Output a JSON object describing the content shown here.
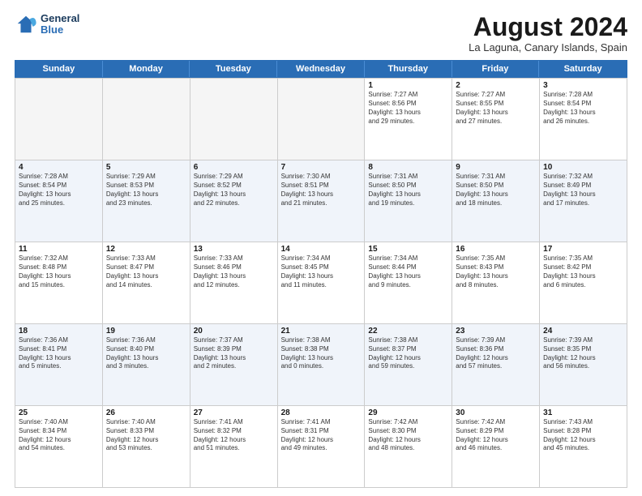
{
  "header": {
    "logo_line1": "General",
    "logo_line2": "Blue",
    "month": "August 2024",
    "location": "La Laguna, Canary Islands, Spain"
  },
  "days_of_week": [
    "Sunday",
    "Monday",
    "Tuesday",
    "Wednesday",
    "Thursday",
    "Friday",
    "Saturday"
  ],
  "weeks": [
    [
      {
        "day": "",
        "info": "",
        "empty": true
      },
      {
        "day": "",
        "info": "",
        "empty": true
      },
      {
        "day": "",
        "info": "",
        "empty": true
      },
      {
        "day": "",
        "info": "",
        "empty": true
      },
      {
        "day": "1",
        "info": "Sunrise: 7:27 AM\nSunset: 8:56 PM\nDaylight: 13 hours\nand 29 minutes."
      },
      {
        "day": "2",
        "info": "Sunrise: 7:27 AM\nSunset: 8:55 PM\nDaylight: 13 hours\nand 27 minutes."
      },
      {
        "day": "3",
        "info": "Sunrise: 7:28 AM\nSunset: 8:54 PM\nDaylight: 13 hours\nand 26 minutes."
      }
    ],
    [
      {
        "day": "4",
        "info": "Sunrise: 7:28 AM\nSunset: 8:54 PM\nDaylight: 13 hours\nand 25 minutes."
      },
      {
        "day": "5",
        "info": "Sunrise: 7:29 AM\nSunset: 8:53 PM\nDaylight: 13 hours\nand 23 minutes."
      },
      {
        "day": "6",
        "info": "Sunrise: 7:29 AM\nSunset: 8:52 PM\nDaylight: 13 hours\nand 22 minutes."
      },
      {
        "day": "7",
        "info": "Sunrise: 7:30 AM\nSunset: 8:51 PM\nDaylight: 13 hours\nand 21 minutes."
      },
      {
        "day": "8",
        "info": "Sunrise: 7:31 AM\nSunset: 8:50 PM\nDaylight: 13 hours\nand 19 minutes."
      },
      {
        "day": "9",
        "info": "Sunrise: 7:31 AM\nSunset: 8:50 PM\nDaylight: 13 hours\nand 18 minutes."
      },
      {
        "day": "10",
        "info": "Sunrise: 7:32 AM\nSunset: 8:49 PM\nDaylight: 13 hours\nand 17 minutes."
      }
    ],
    [
      {
        "day": "11",
        "info": "Sunrise: 7:32 AM\nSunset: 8:48 PM\nDaylight: 13 hours\nand 15 minutes."
      },
      {
        "day": "12",
        "info": "Sunrise: 7:33 AM\nSunset: 8:47 PM\nDaylight: 13 hours\nand 14 minutes."
      },
      {
        "day": "13",
        "info": "Sunrise: 7:33 AM\nSunset: 8:46 PM\nDaylight: 13 hours\nand 12 minutes."
      },
      {
        "day": "14",
        "info": "Sunrise: 7:34 AM\nSunset: 8:45 PM\nDaylight: 13 hours\nand 11 minutes."
      },
      {
        "day": "15",
        "info": "Sunrise: 7:34 AM\nSunset: 8:44 PM\nDaylight: 13 hours\nand 9 minutes."
      },
      {
        "day": "16",
        "info": "Sunrise: 7:35 AM\nSunset: 8:43 PM\nDaylight: 13 hours\nand 8 minutes."
      },
      {
        "day": "17",
        "info": "Sunrise: 7:35 AM\nSunset: 8:42 PM\nDaylight: 13 hours\nand 6 minutes."
      }
    ],
    [
      {
        "day": "18",
        "info": "Sunrise: 7:36 AM\nSunset: 8:41 PM\nDaylight: 13 hours\nand 5 minutes."
      },
      {
        "day": "19",
        "info": "Sunrise: 7:36 AM\nSunset: 8:40 PM\nDaylight: 13 hours\nand 3 minutes."
      },
      {
        "day": "20",
        "info": "Sunrise: 7:37 AM\nSunset: 8:39 PM\nDaylight: 13 hours\nand 2 minutes."
      },
      {
        "day": "21",
        "info": "Sunrise: 7:38 AM\nSunset: 8:38 PM\nDaylight: 13 hours\nand 0 minutes."
      },
      {
        "day": "22",
        "info": "Sunrise: 7:38 AM\nSunset: 8:37 PM\nDaylight: 12 hours\nand 59 minutes."
      },
      {
        "day": "23",
        "info": "Sunrise: 7:39 AM\nSunset: 8:36 PM\nDaylight: 12 hours\nand 57 minutes."
      },
      {
        "day": "24",
        "info": "Sunrise: 7:39 AM\nSunset: 8:35 PM\nDaylight: 12 hours\nand 56 minutes."
      }
    ],
    [
      {
        "day": "25",
        "info": "Sunrise: 7:40 AM\nSunset: 8:34 PM\nDaylight: 12 hours\nand 54 minutes."
      },
      {
        "day": "26",
        "info": "Sunrise: 7:40 AM\nSunset: 8:33 PM\nDaylight: 12 hours\nand 53 minutes."
      },
      {
        "day": "27",
        "info": "Sunrise: 7:41 AM\nSunset: 8:32 PM\nDaylight: 12 hours\nand 51 minutes."
      },
      {
        "day": "28",
        "info": "Sunrise: 7:41 AM\nSunset: 8:31 PM\nDaylight: 12 hours\nand 49 minutes."
      },
      {
        "day": "29",
        "info": "Sunrise: 7:42 AM\nSunset: 8:30 PM\nDaylight: 12 hours\nand 48 minutes."
      },
      {
        "day": "30",
        "info": "Sunrise: 7:42 AM\nSunset: 8:29 PM\nDaylight: 12 hours\nand 46 minutes."
      },
      {
        "day": "31",
        "info": "Sunrise: 7:43 AM\nSunset: 8:28 PM\nDaylight: 12 hours\nand 45 minutes."
      }
    ]
  ]
}
